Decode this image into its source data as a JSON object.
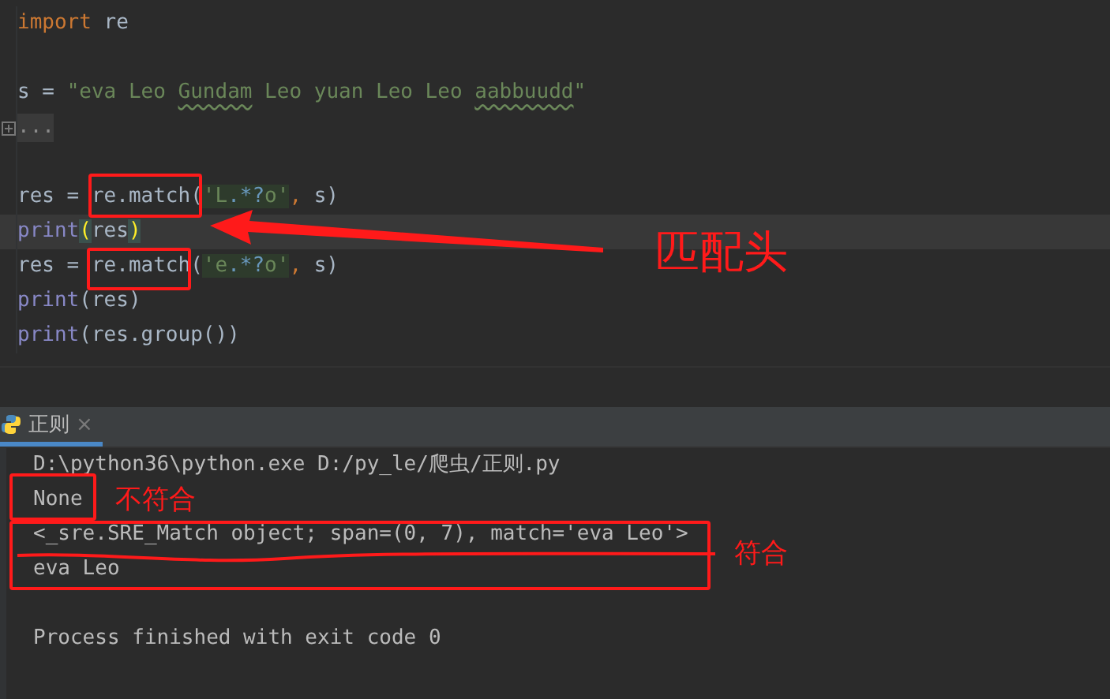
{
  "editor": {
    "lines": [
      {
        "kind": "code",
        "current": false,
        "tokens": [
          {
            "text": "import",
            "kind": "keyword"
          },
          {
            "text": " re",
            "kind": "plain"
          }
        ]
      },
      {
        "kind": "blank",
        "current": false
      },
      {
        "kind": "code",
        "current": false,
        "tokens": [
          {
            "text": "s = ",
            "kind": "plain"
          },
          {
            "text": "\"eva Leo ",
            "kind": "string"
          },
          {
            "text": "Gundam",
            "kind": "string-typo"
          },
          {
            "text": " Leo yuan Leo Leo ",
            "kind": "string"
          },
          {
            "text": "aabbuudd",
            "kind": "string-typo"
          },
          {
            "text": "\"",
            "kind": "string"
          }
        ]
      },
      {
        "kind": "folded",
        "current": false,
        "text": "..."
      },
      {
        "kind": "blank",
        "current": false
      },
      {
        "kind": "code",
        "current": false,
        "tokens": [
          {
            "text": "res = re.match(",
            "kind": "plain"
          },
          {
            "text": "'L",
            "kind": "regex"
          },
          {
            "text": ".*?",
            "kind": "regex-meta"
          },
          {
            "text": "o'",
            "kind": "regex"
          },
          {
            "text": ",",
            "kind": "comma"
          },
          {
            "text": " s)",
            "kind": "plain"
          }
        ]
      },
      {
        "kind": "code",
        "current": true,
        "tokens": [
          {
            "text": "print",
            "kind": "builtin"
          },
          {
            "text": "(",
            "kind": "brace-match"
          },
          {
            "text": "res",
            "kind": "plain"
          },
          {
            "text": ")",
            "kind": "brace-match"
          }
        ]
      },
      {
        "kind": "code",
        "current": false,
        "tokens": [
          {
            "text": "res = re.match(",
            "kind": "plain"
          },
          {
            "text": "'e",
            "kind": "regex"
          },
          {
            "text": ".*?",
            "kind": "regex-meta"
          },
          {
            "text": "o'",
            "kind": "regex"
          },
          {
            "text": ",",
            "kind": "comma"
          },
          {
            "text": " s)",
            "kind": "plain"
          }
        ]
      },
      {
        "kind": "code",
        "current": false,
        "tokens": [
          {
            "text": "print",
            "kind": "builtin"
          },
          {
            "text": "(res)",
            "kind": "plain"
          }
        ]
      },
      {
        "kind": "code",
        "current": false,
        "tokens": [
          {
            "text": "print",
            "kind": "builtin"
          },
          {
            "text": "(res.group())",
            "kind": "plain"
          }
        ]
      }
    ]
  },
  "run_panel": {
    "tabs": [
      {
        "label": "正则",
        "close": "×",
        "selected": true
      }
    ],
    "console": [
      {
        "kind": "text",
        "text": "D:\\python36\\python.exe D:/py_le/爬虫/正则.py"
      },
      {
        "kind": "text",
        "text": "None"
      },
      {
        "kind": "text",
        "text": "<_sre.SRE_Match object; span=(0, 7), match='eva Leo'>"
      },
      {
        "kind": "text",
        "text": "eva Leo"
      },
      {
        "kind": "blank"
      },
      {
        "kind": "text",
        "text": "Process finished with exit code 0"
      }
    ]
  },
  "annotations": [
    {
      "text": "匹配头"
    },
    {
      "text": "不符合"
    },
    {
      "text": "符合"
    }
  ]
}
